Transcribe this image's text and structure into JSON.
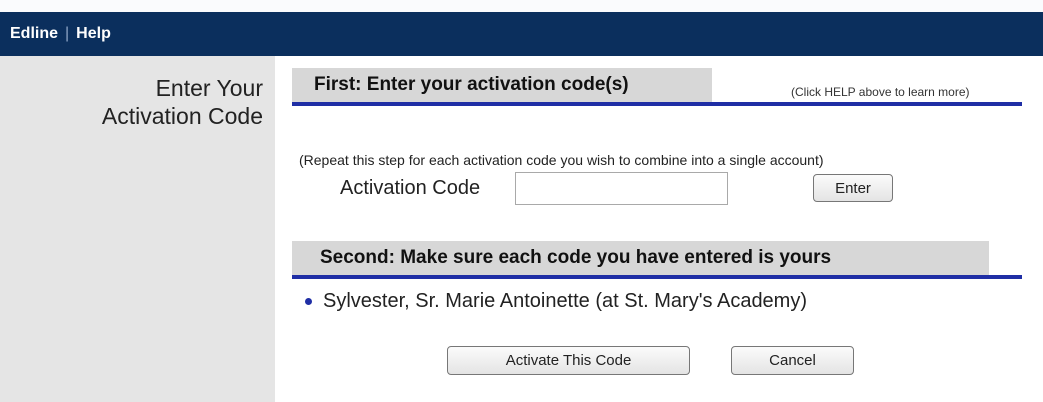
{
  "nav": {
    "edline": "Edline",
    "help": "Help",
    "separator": "|"
  },
  "sidebar": {
    "title_line1": "Enter Your",
    "title_line2": "Activation Code"
  },
  "step1": {
    "heading": "First: Enter your activation code(s)",
    "hint": "(Click HELP above to learn more)",
    "repeat_note": "(Repeat this step for each activation code you wish to combine into a single account)",
    "field_label": "Activation Code",
    "field_value": "",
    "enter_label": "Enter"
  },
  "step2": {
    "heading": "Second: Make sure each code you have entered is yours",
    "codes": [
      "Sylvester, Sr. Marie Antoinette (at St. Mary's Academy)"
    ],
    "activate_label": "Activate This Code",
    "cancel_label": "Cancel"
  },
  "colors": {
    "navbar": "#0b2f5d",
    "rule": "#1f2ea5",
    "section_bg": "#d7d7d7",
    "sidebar_bg": "#e5e5e5"
  }
}
